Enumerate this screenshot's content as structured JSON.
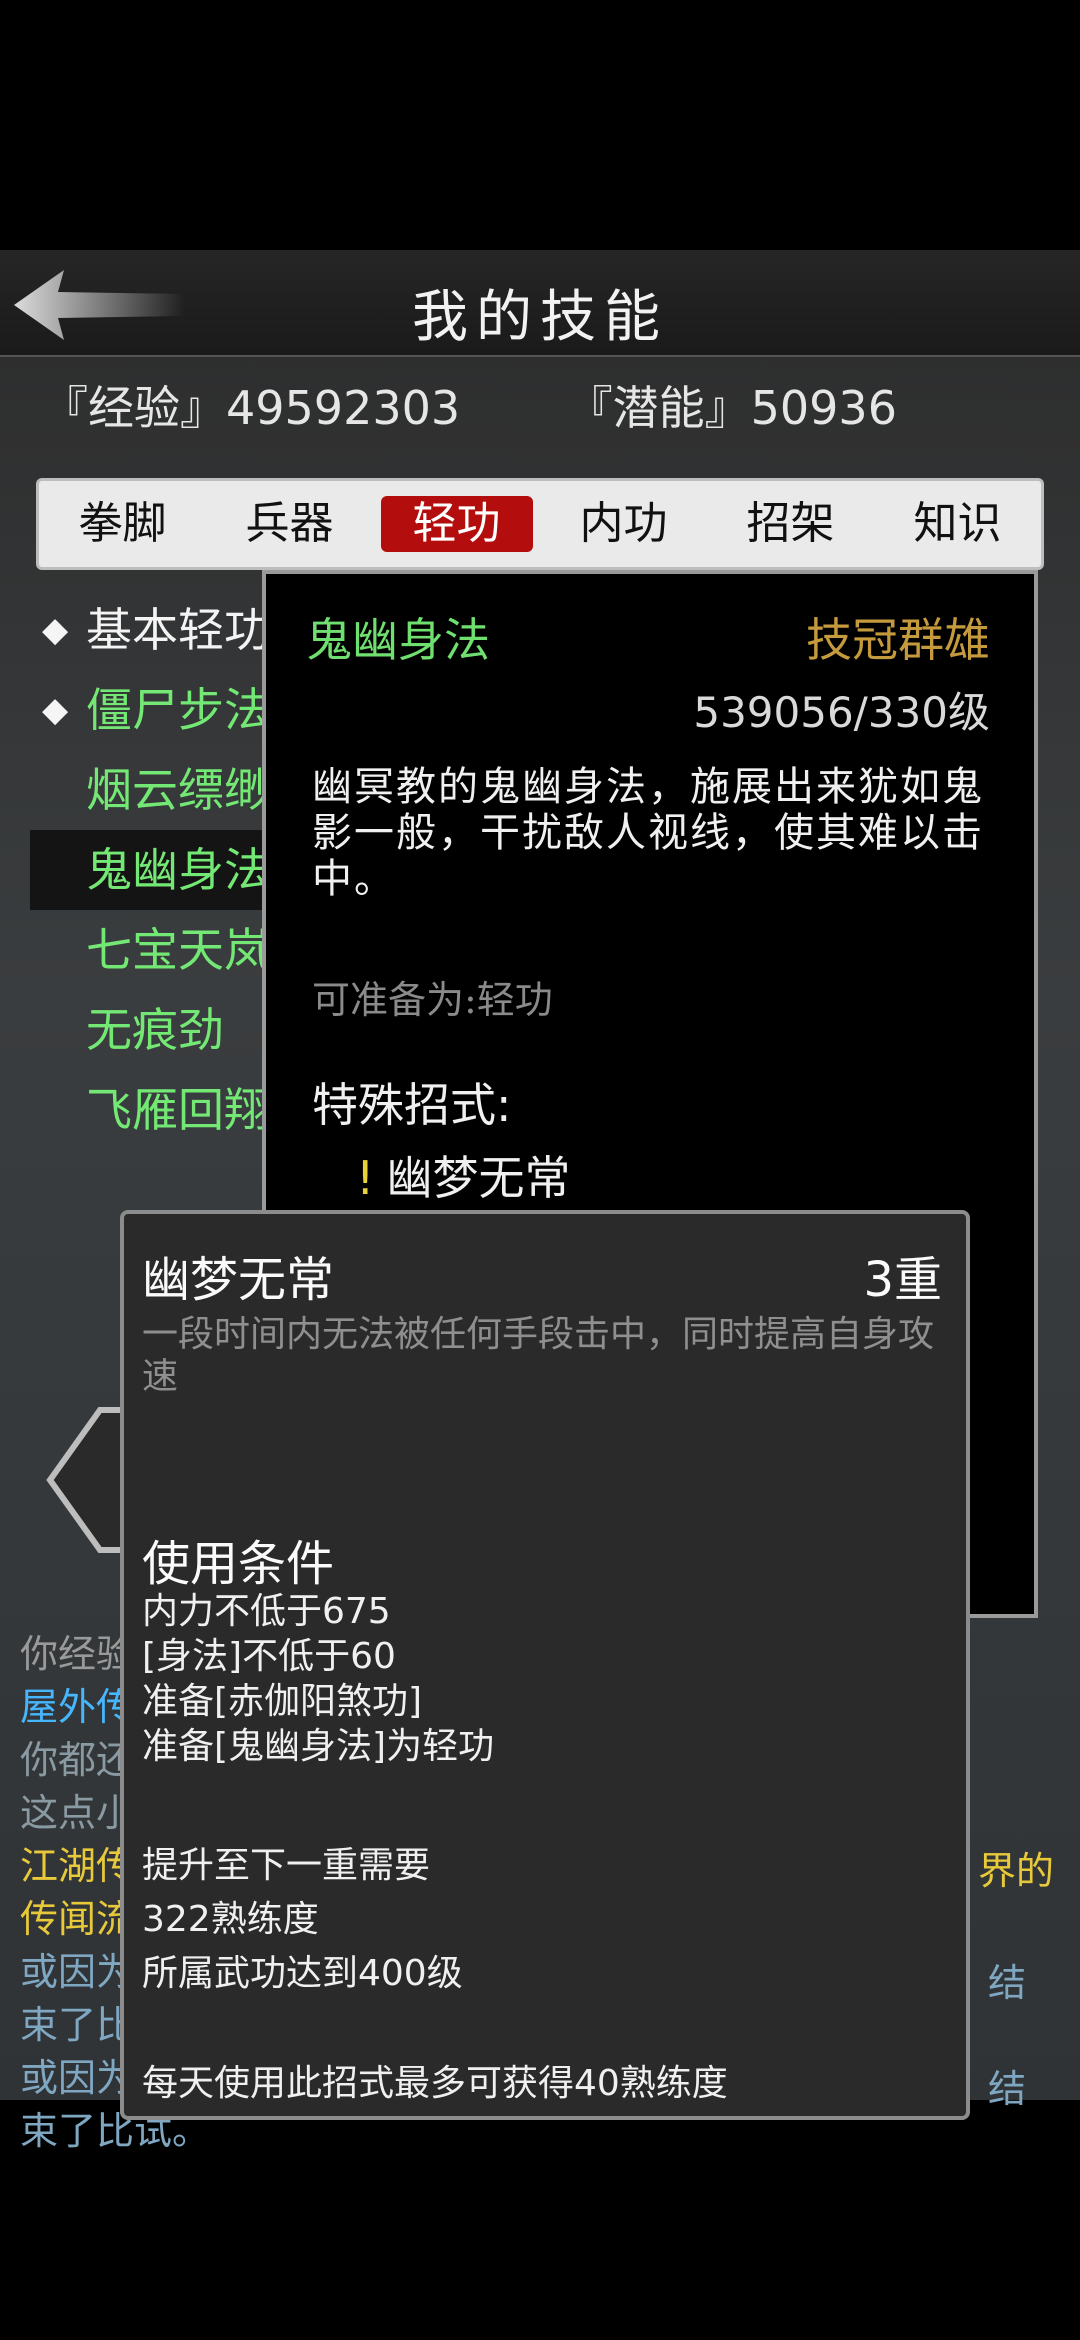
{
  "header": {
    "title": "我的技能",
    "back_icon": "back-arrow-icon"
  },
  "stats": {
    "exp": "『经验』49592303",
    "potential": "『潜能』50936"
  },
  "tabs": [
    {
      "label": "拳脚",
      "active": false
    },
    {
      "label": "兵器",
      "active": false
    },
    {
      "label": "轻功",
      "active": true
    },
    {
      "label": "内功",
      "active": false
    },
    {
      "label": "招架",
      "active": false
    },
    {
      "label": "知识",
      "active": false
    }
  ],
  "skills": [
    {
      "label": "基本轻功",
      "bullet": "◆",
      "color": "white"
    },
    {
      "label": "僵尸步法",
      "bullet": "◆",
      "color": "green"
    },
    {
      "label": "烟云缥缈",
      "bullet": "",
      "color": "green"
    },
    {
      "label": "鬼幽身法",
      "bullet": "",
      "color": "green",
      "selected": true
    },
    {
      "label": "七宝天岚",
      "bullet": "",
      "color": "green"
    },
    {
      "label": "无痕劲",
      "bullet": "",
      "color": "green"
    },
    {
      "label": "飞雁回翔",
      "bullet": "",
      "color": "green"
    }
  ],
  "detail": {
    "name": "鬼幽身法",
    "rank": "技冠群雄",
    "level": "539056/330级",
    "desc": "幽冥教的鬼幽身法，施展出来犹如鬼影一般，干扰敌人视线，使其难以击中。",
    "prep": "可准备为:轻功",
    "special_title": "特殊招式:",
    "move_mark": "!",
    "move_name": "幽梦无常"
  },
  "log": {
    "line1": "你经验",
    "line2": "屋外传",
    "line3": "你都还",
    "line4": "这点小",
    "line5": "江湖传",
    "line5_right": "界的",
    "line6": "传闻流",
    "line7": "或因为",
    "line7_right": "结",
    "line8": "束了比",
    "line9": "或因为",
    "line9_right": "结",
    "line10": "束了比试。"
  },
  "tooltip": {
    "name": "幽梦无常",
    "level": "3重",
    "desc": "一段时间内无法被任何手段击中，同时提高自身攻速",
    "cond_title": "使用条件",
    "cond1": "内力不低于675",
    "cond2": "[身法]不低于60",
    "cond3": "准备[赤伽阳煞功]",
    "cond4": "准备[鬼幽身法]为轻功",
    "up1": "提升至下一重需要",
    "up2": "322熟练度",
    "up3": "所属武功达到400级",
    "daily": "每天使用此招式最多可获得40熟练度"
  }
}
